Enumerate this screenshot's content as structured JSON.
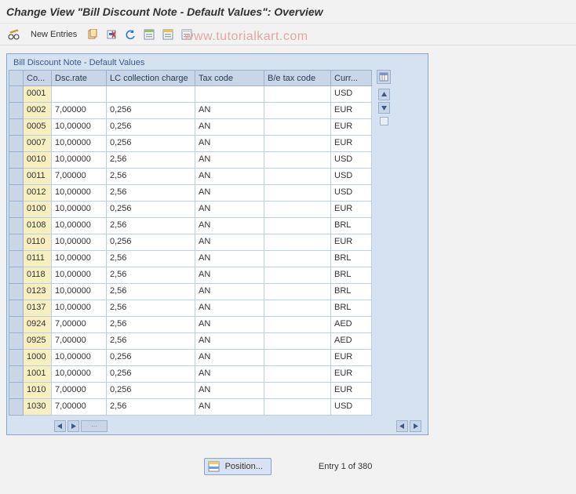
{
  "header": {
    "title": "Change View \"Bill Discount Note - Default Values\": Overview"
  },
  "toolbar": {
    "new_entries_label": "New Entries"
  },
  "watermark": "www.tutorialkart.com",
  "panel": {
    "title": "Bill Discount Note - Default Values",
    "columns": {
      "co": "Co...",
      "rate": "Dsc.rate",
      "lc": "LC collection charge",
      "tax": "Tax code",
      "be": "B/e tax code",
      "curr": "Curr..."
    },
    "rows": [
      {
        "co": "0001",
        "rate": "",
        "lc": "",
        "tax": "",
        "be": "",
        "curr": "USD"
      },
      {
        "co": "0002",
        "rate": "7,00000",
        "lc": "0,256",
        "tax": "AN",
        "be": "",
        "curr": "EUR"
      },
      {
        "co": "0005",
        "rate": "10,00000",
        "lc": "0,256",
        "tax": "AN",
        "be": "",
        "curr": "EUR"
      },
      {
        "co": "0007",
        "rate": "10,00000",
        "lc": "0,256",
        "tax": "AN",
        "be": "",
        "curr": "EUR"
      },
      {
        "co": "0010",
        "rate": "10,00000",
        "lc": "2,56",
        "tax": "AN",
        "be": "",
        "curr": "USD"
      },
      {
        "co": "0011",
        "rate": "7,00000",
        "lc": "2,56",
        "tax": "AN",
        "be": "",
        "curr": "USD"
      },
      {
        "co": "0012",
        "rate": "10,00000",
        "lc": "2,56",
        "tax": "AN",
        "be": "",
        "curr": "USD"
      },
      {
        "co": "0100",
        "rate": "10,00000",
        "lc": "0,256",
        "tax": "AN",
        "be": "",
        "curr": "EUR"
      },
      {
        "co": "0108",
        "rate": "10,00000",
        "lc": "2,56",
        "tax": "AN",
        "be": "",
        "curr": "BRL"
      },
      {
        "co": "0110",
        "rate": "10,00000",
        "lc": "0,256",
        "tax": "AN",
        "be": "",
        "curr": "EUR"
      },
      {
        "co": "0111",
        "rate": "10,00000",
        "lc": "2,56",
        "tax": "AN",
        "be": "",
        "curr": "BRL"
      },
      {
        "co": "0118",
        "rate": "10,00000",
        "lc": "2,56",
        "tax": "AN",
        "be": "",
        "curr": "BRL"
      },
      {
        "co": "0123",
        "rate": "10,00000",
        "lc": "2,56",
        "tax": "AN",
        "be": "",
        "curr": "BRL"
      },
      {
        "co": "0137",
        "rate": "10,00000",
        "lc": "2,56",
        "tax": "AN",
        "be": "",
        "curr": "BRL"
      },
      {
        "co": "0924",
        "rate": "7,00000",
        "lc": "2,56",
        "tax": "AN",
        "be": "",
        "curr": "AED"
      },
      {
        "co": "0925",
        "rate": "7,00000",
        "lc": "2,56",
        "tax": "AN",
        "be": "",
        "curr": "AED"
      },
      {
        "co": "1000",
        "rate": "10,00000",
        "lc": "0,256",
        "tax": "AN",
        "be": "",
        "curr": "EUR"
      },
      {
        "co": "1001",
        "rate": "10,00000",
        "lc": "0,256",
        "tax": "AN",
        "be": "",
        "curr": "EUR"
      },
      {
        "co": "1010",
        "rate": "7,00000",
        "lc": "0,256",
        "tax": "AN",
        "be": "",
        "curr": "EUR"
      },
      {
        "co": "1030",
        "rate": "7,00000",
        "lc": "2,56",
        "tax": "AN",
        "be": "",
        "curr": "USD"
      }
    ]
  },
  "footer": {
    "position_label": "Position...",
    "entry_text": "Entry 1 of 380"
  },
  "colors": {
    "panel_border": "#8aa4c8",
    "header_cell": "#c9d6e8",
    "key_cell": "#f7efc0"
  }
}
